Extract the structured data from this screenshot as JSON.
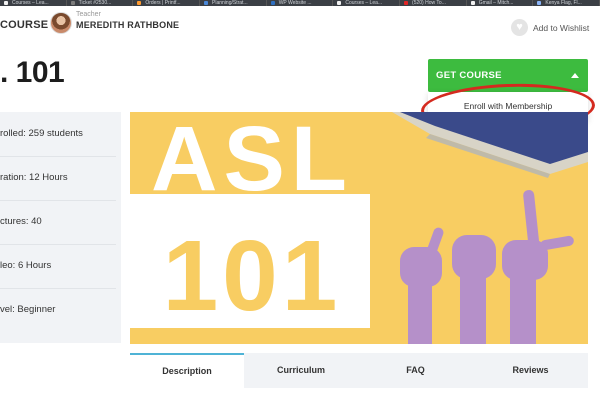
{
  "browser": {
    "tabs": [
      {
        "label": "Courses – Lea...",
        "icon_color": "#f2f2f2"
      },
      {
        "label": "Ticket #2530...",
        "icon_color": "#7c7c7c"
      },
      {
        "label": "Orders | Printf...",
        "icon_color": "#ff9a2e"
      },
      {
        "label": "Planning/Strat...",
        "icon_color": "#4a88d8"
      },
      {
        "label": "WP Website ...",
        "icon_color": "#2f6fc0"
      },
      {
        "label": "Courses – Lea...",
        "icon_color": "#f2f2f2"
      },
      {
        "label": "(520) How To...",
        "icon_color": "#e12626"
      },
      {
        "label": "Gmail – Mitch...",
        "icon_color": "#f2f2f2"
      },
      {
        "label": "Kenya Flag, Fl...",
        "icon_color": "#8ab4f8"
      }
    ]
  },
  "header": {
    "course_label_top": "",
    "course_label": "COURSE",
    "teacher_role": "Teacher",
    "teacher_name": "MEREDITH RATHBONE",
    "wishlist_icon": "heart-icon",
    "wishlist_label": "Add to Wishlist"
  },
  "course": {
    "title": ". 101"
  },
  "purchase": {
    "button_label": "GET COURSE",
    "dropdown_items": [
      "Enroll with Membership"
    ],
    "accent": "#3dbb3f",
    "annotation_color": "#d42a1f"
  },
  "info": [
    "rolled: 259 students",
    "ration: 12 Hours",
    "ctures: 40",
    "leo: 6 Hours",
    "vel: Beginner"
  ],
  "hero": {
    "line1": "ASL",
    "line2": "101",
    "background": "#f8cd62"
  },
  "tabs": [
    {
      "label": "Description",
      "active": true
    },
    {
      "label": "Curriculum",
      "active": false
    },
    {
      "label": "FAQ",
      "active": false
    },
    {
      "label": "Reviews",
      "active": false
    }
  ]
}
